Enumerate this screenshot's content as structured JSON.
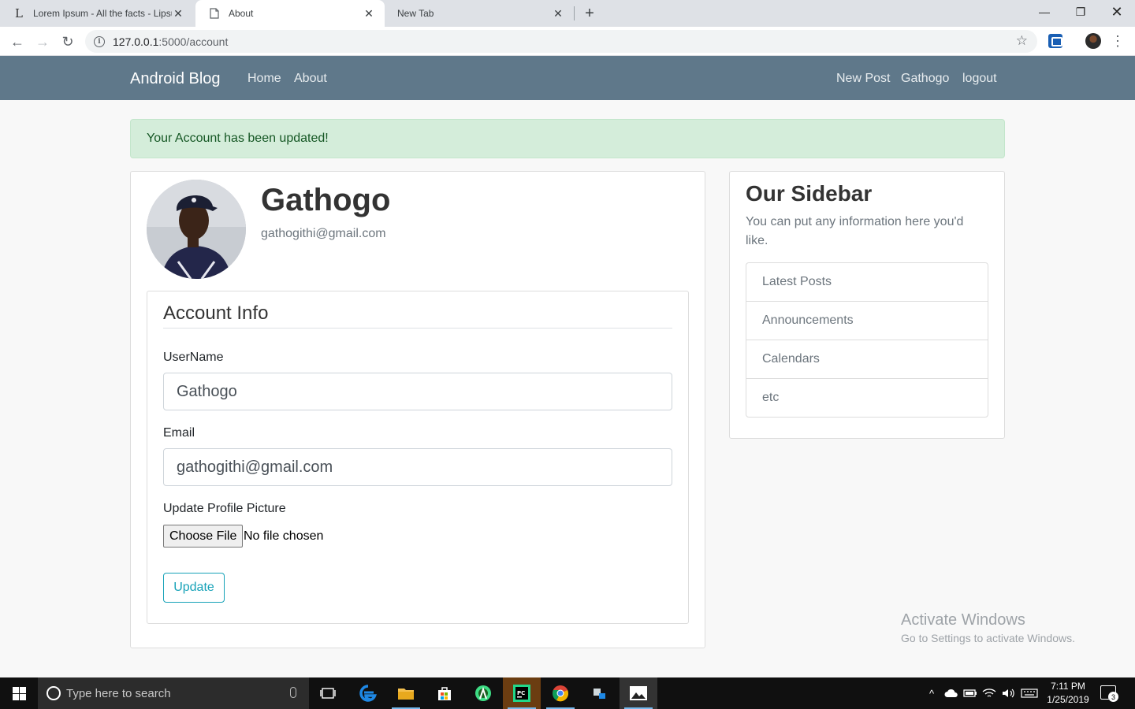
{
  "browser": {
    "tabs": [
      {
        "title": "Lorem Ipsum - All the facts - Lipsum",
        "favicon": "L"
      },
      {
        "title": "About"
      },
      {
        "title": "New Tab"
      }
    ],
    "url_host": "127.0.0.1",
    "url_path": ":5000/account"
  },
  "navbar": {
    "brand": "Android Blog",
    "left_links": [
      "Home",
      "About"
    ],
    "right_links": [
      "New Post",
      "Gathogo",
      "logout"
    ],
    "bg_color": "#5f788a"
  },
  "alert": {
    "message": "Your Account has been updated!"
  },
  "profile": {
    "username": "Gathogo",
    "email": "gathogithi@gmail.com"
  },
  "form": {
    "legend": "Account Info",
    "username_label": "UserName",
    "username_value": "Gathogo",
    "email_label": "Email",
    "email_value": "gathogithi@gmail.com",
    "picture_label": "Update Profile Picture",
    "choose_file": "Choose File",
    "file_status": "No file chosen",
    "submit": "Update"
  },
  "sidebar": {
    "title": "Our Sidebar",
    "text": "You can put any information here you'd like.",
    "items": [
      "Latest Posts",
      "Announcements",
      "Calendars",
      "etc"
    ]
  },
  "watermark": {
    "line1": "Activate Windows",
    "line2": "Go to Settings to activate Windows."
  },
  "taskbar": {
    "search_placeholder": "Type here to search",
    "time": "7:11 PM",
    "date": "1/25/2019",
    "notification_count": "3"
  }
}
